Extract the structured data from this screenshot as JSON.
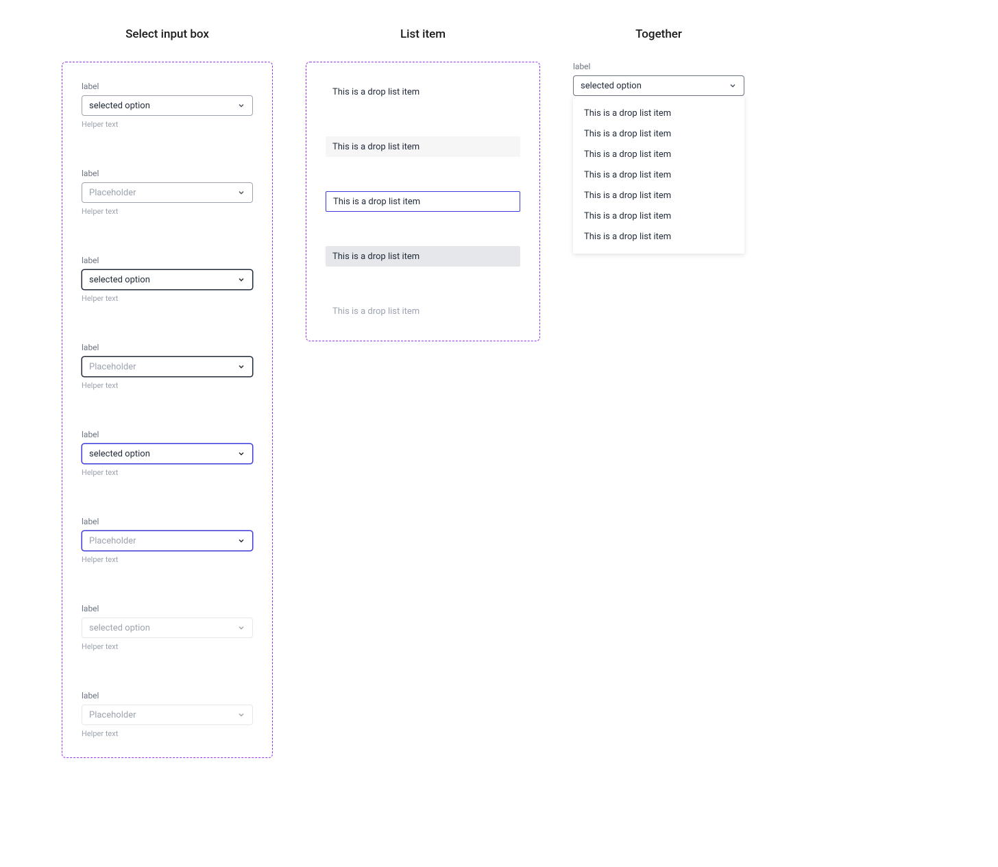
{
  "columns": {
    "select_title": "Select input box",
    "list_title": "List item",
    "together_title": "Together"
  },
  "select_groups": [
    {
      "label": "label",
      "value_text": "selected option",
      "is_placeholder": false,
      "helper": "Helper text",
      "state": "default"
    },
    {
      "label": "label",
      "value_text": "Placeholder",
      "is_placeholder": true,
      "helper": "Helper text",
      "state": "default"
    },
    {
      "label": "label",
      "value_text": "selected option",
      "is_placeholder": false,
      "helper": "Helper text",
      "state": "hover"
    },
    {
      "label": "label",
      "value_text": "Placeholder",
      "is_placeholder": true,
      "helper": "Helper text",
      "state": "hover"
    },
    {
      "label": "label",
      "value_text": "selected option",
      "is_placeholder": false,
      "helper": "Helper text",
      "state": "active"
    },
    {
      "label": "label",
      "value_text": "Placeholder",
      "is_placeholder": true,
      "helper": "Helper text",
      "state": "active"
    },
    {
      "label": "label",
      "value_text": "selected option",
      "is_placeholder": false,
      "helper": "Helper text",
      "state": "disabled"
    },
    {
      "label": "label",
      "value_text": "Placeholder",
      "is_placeholder": true,
      "helper": "Helper text",
      "state": "disabled"
    }
  ],
  "list_items": [
    {
      "text": "This is a drop list item",
      "state": "default"
    },
    {
      "text": "This is a drop list item",
      "state": "hover"
    },
    {
      "text": "This is a drop list item",
      "state": "active"
    },
    {
      "text": "This is a drop list item",
      "state": "selected"
    },
    {
      "text": "This is a drop list item",
      "state": "disabled"
    }
  ],
  "together": {
    "label": "label",
    "value_text": "selected option",
    "options": [
      "This is a drop list item",
      "This is a drop list item",
      "This is a drop list item",
      "This is a drop list item",
      "This is a drop list item",
      "This is a drop list item",
      "This is a drop list item"
    ]
  }
}
